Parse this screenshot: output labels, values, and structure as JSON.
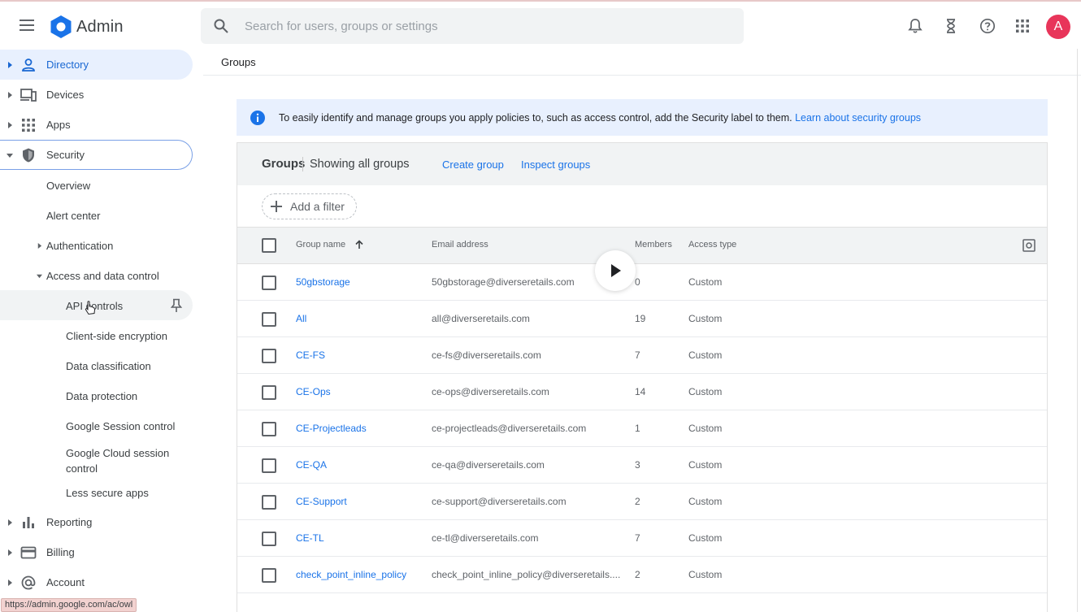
{
  "app": {
    "name": "Admin",
    "avatar_letter": "A"
  },
  "search": {
    "placeholder": "Search for users, groups or settings"
  },
  "breadcrumb": "Groups",
  "sidebar": {
    "items": [
      {
        "label": "Directory",
        "icon": "person-icon"
      },
      {
        "label": "Devices",
        "icon": "devices-icon"
      },
      {
        "label": "Apps",
        "icon": "apps-grid-icon"
      },
      {
        "label": "Security",
        "icon": "shield-icon"
      }
    ],
    "security_sub": [
      "Overview",
      "Alert center",
      "Authentication",
      "Access and data control"
    ],
    "access_sub": [
      "API controls",
      "Client-side encryption",
      "Data classification",
      "Data protection",
      "Google Session control",
      "Google Cloud session",
      "control",
      "Less secure apps"
    ],
    "bottom_items": [
      {
        "label": "Reporting",
        "icon": "bar-chart-icon"
      },
      {
        "label": "Billing",
        "icon": "credit-card-icon"
      },
      {
        "label": "Account",
        "icon": "at-sign-icon"
      }
    ]
  },
  "banner": {
    "text": "To easily identify and manage groups you apply policies to, such as access control, add the Security label to them. ",
    "link": "Learn about security groups"
  },
  "card": {
    "title": "Groups",
    "subtitle": "Showing all groups",
    "create_link": "Create group",
    "inspect_link": "Inspect groups",
    "filter_label": "Add a filter"
  },
  "table": {
    "columns": [
      "Group name",
      "Email address",
      "Members",
      "Access type"
    ],
    "rows": [
      {
        "name": "50gbstorage",
        "email": "50gbstorage@diverseretails.com",
        "members": "0",
        "access": "Custom"
      },
      {
        "name": "All",
        "email": "all@diverseretails.com",
        "members": "19",
        "access": "Custom"
      },
      {
        "name": "CE-FS",
        "email": "ce-fs@diverseretails.com",
        "members": "7",
        "access": "Custom"
      },
      {
        "name": "CE-Ops",
        "email": "ce-ops@diverseretails.com",
        "members": "14",
        "access": "Custom"
      },
      {
        "name": "CE-Projectleads",
        "email": "ce-projectleads@diverseretails.com",
        "members": "1",
        "access": "Custom"
      },
      {
        "name": "CE-QA",
        "email": "ce-qa@diverseretails.com",
        "members": "3",
        "access": "Custom"
      },
      {
        "name": "CE-Support",
        "email": "ce-support@diverseretails.com",
        "members": "2",
        "access": "Custom"
      },
      {
        "name": "CE-TL",
        "email": "ce-tl@diverseretails.com",
        "members": "7",
        "access": "Custom"
      },
      {
        "name": "check_point_inline_policy",
        "email": "check_point_inline_policy@diverseretails....",
        "members": "2",
        "access": "Custom"
      }
    ]
  },
  "status_url": "https://admin.google.com/ac/owl",
  "colors": {
    "accent": "#1a73e8",
    "banner_bg": "#e8f0fe",
    "avatar": "#e8355a"
  }
}
